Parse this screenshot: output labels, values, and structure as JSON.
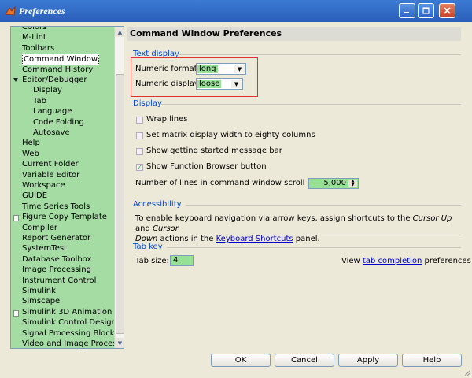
{
  "window": {
    "title": "Preferences",
    "minimize_icon": "minimize-icon",
    "maximize_icon": "maximize-icon",
    "close_icon": "close-icon"
  },
  "tree": {
    "items": [
      {
        "label": "Colors",
        "indent": 1
      },
      {
        "label": "M-Lint",
        "indent": 1
      },
      {
        "label": "Toolbars",
        "indent": 1
      },
      {
        "label": "Command Window",
        "indent": 1,
        "selected": true
      },
      {
        "label": "Command History",
        "indent": 1
      },
      {
        "label": "Editor/Debugger",
        "indent": 1,
        "expanded": true
      },
      {
        "label": "Display",
        "indent": 2
      },
      {
        "label": "Tab",
        "indent": 2
      },
      {
        "label": "Language",
        "indent": 2
      },
      {
        "label": "Code Folding",
        "indent": 2
      },
      {
        "label": "Autosave",
        "indent": 2
      },
      {
        "label": "Help",
        "indent": 1
      },
      {
        "label": "Web",
        "indent": 1
      },
      {
        "label": "Current Folder",
        "indent": 1
      },
      {
        "label": "Variable Editor",
        "indent": 1
      },
      {
        "label": "Workspace",
        "indent": 1
      },
      {
        "label": "GUIDE",
        "indent": 1
      },
      {
        "label": "Time Series Tools",
        "indent": 1
      },
      {
        "label": "Figure Copy Template",
        "indent": 1,
        "collapsed": true
      },
      {
        "label": "Compiler",
        "indent": 1
      },
      {
        "label": "Report Generator",
        "indent": 1
      },
      {
        "label": "SystemTest",
        "indent": 1
      },
      {
        "label": "Database Toolbox",
        "indent": 1
      },
      {
        "label": "Image Processing",
        "indent": 1
      },
      {
        "label": "Instrument Control",
        "indent": 1
      },
      {
        "label": "Simulink",
        "indent": 1
      },
      {
        "label": "Simscape",
        "indent": 1
      },
      {
        "label": "Simulink 3D Animation",
        "indent": 1,
        "collapsed": true
      },
      {
        "label": "Simulink Control Design",
        "indent": 1
      },
      {
        "label": "Signal Processing Blockset",
        "indent": 1
      },
      {
        "label": "Video and Image Processing",
        "indent": 1
      }
    ]
  },
  "panel": {
    "header": "Command Window Preferences",
    "text_display": {
      "title": "Text display",
      "numeric_format_label": "Numeric format:",
      "numeric_format_value": "long",
      "numeric_display_label": "Numeric display:",
      "numeric_display_value": "loose"
    },
    "display": {
      "title": "Display",
      "checkboxes": [
        {
          "label": "Wrap lines",
          "checked": false
        },
        {
          "label": "Set matrix display width to eighty columns",
          "checked": false
        },
        {
          "label": "Show getting started message bar",
          "checked": false
        },
        {
          "label": "Show Function Browser button",
          "checked": true
        }
      ],
      "scroll_buffer_label": "Number of lines in command window scroll buffer:",
      "scroll_buffer_value": "5,000"
    },
    "accessibility": {
      "title": "Accessibility",
      "text_1": "To enable keyboard navigation via arrow keys, assign shortcuts to the",
      "cursor_up": "Cursor Up",
      "and": "and",
      "cursor_word": "Cursor",
      "down": "Down",
      "text_2": "actions in the",
      "shortcuts_link": "Keyboard Shortcuts",
      "panel_word": "panel."
    },
    "tab_key": {
      "title": "Tab key",
      "tab_size_label": "Tab size:",
      "tab_size_value": "4",
      "view_text": "View",
      "tab_completion_link": "tab completion",
      "preferences_text": "preferences"
    }
  },
  "buttons": {
    "ok": "OK",
    "cancel": "Cancel",
    "apply": "Apply",
    "help": "Help"
  },
  "colors": {
    "title_bar": "#2a5fb8",
    "tree_bg": "#a4dca4",
    "field_highlight": "#97e197",
    "section_title": "#0046d5",
    "red_outline": "#d33333"
  }
}
